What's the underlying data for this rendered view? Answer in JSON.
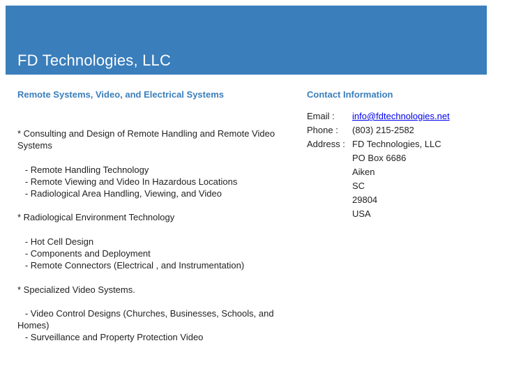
{
  "header": {
    "title": "FD Technologies, LLC"
  },
  "main": {
    "heading": "Remote Systems, Video, and Electrical Systems",
    "lines": [
      "* Consulting and Design of Remote Handling and Remote Video Systems",
      "",
      "   - Remote Handling Technology",
      "   - Remote Viewing and Video In Hazardous Locations",
      "   - Radiological Area Handling, Viewing, and Video",
      "",
      "* Radiological Environment Technology",
      "",
      "   - Hot Cell Design",
      "   - Components and Deployment",
      "   - Remote Connectors (Electrical , and Instrumentation)",
      "",
      "* Specialized Video Systems.",
      "",
      "   - Video Control Designs (Churches, Businesses, Schools, and Homes)",
      "   - Surveillance and Property Protection Video"
    ]
  },
  "contact": {
    "heading": "Contact Information",
    "email_label": "Email :",
    "email": "info@fdtechnologies.net",
    "phone_label": "Phone :",
    "phone": "(803) 215-2582",
    "address_label": "Address :",
    "address": [
      "FD Technologies, LLC",
      "PO Box 6686",
      "Aiken",
      "SC",
      "29804",
      "USA"
    ]
  }
}
